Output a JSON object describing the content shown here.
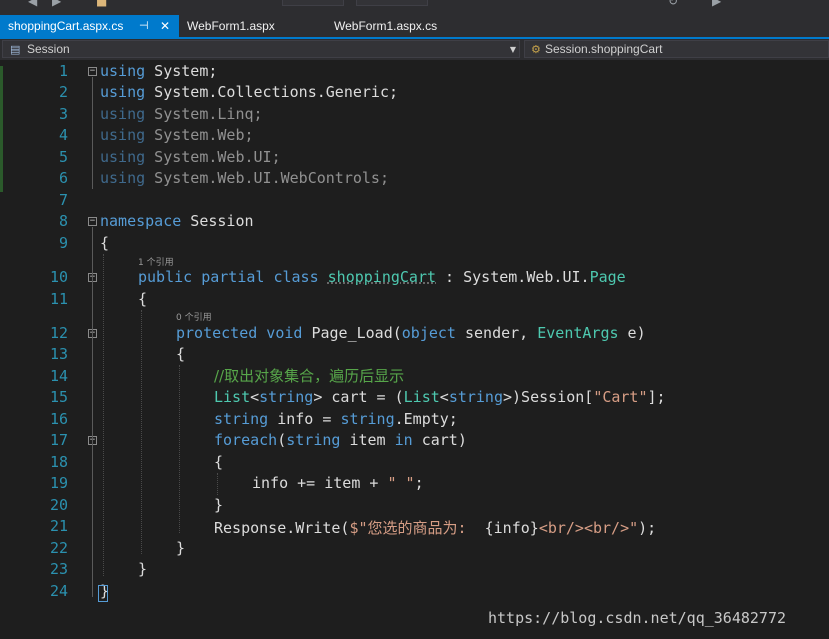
{
  "tabs": [
    {
      "label": "shoppingCart.aspx.cs",
      "active": true
    },
    {
      "label": "WebForm1.aspx",
      "active": false
    },
    {
      "label": "WebForm1.aspx.cs",
      "active": false
    }
  ],
  "nav": {
    "left": "Session",
    "right": "Session.shoppingCart"
  },
  "code": {
    "line_numbers": [
      "1",
      "2",
      "3",
      "4",
      "5",
      "6",
      "7",
      "8",
      "9",
      "10",
      "11",
      "12",
      "13",
      "14",
      "15",
      "16",
      "17",
      "18",
      "19",
      "20",
      "21",
      "22",
      "23",
      "24"
    ],
    "l1_kw": "using",
    "l1_rest": " System;",
    "l2_kw": "using",
    "l2_rest": " System.Collections.Generic;",
    "l3_kw": "using",
    "l3_rest": " System.Linq;",
    "l4_kw": "using",
    "l4_rest": " System.Web;",
    "l5_kw": "using",
    "l5_rest": " System.Web.UI;",
    "l6_kw": "using",
    "l6_rest": " System.Web.UI.WebControls;",
    "l8_kw": "namespace",
    "l8_rest": " Session",
    "l9": "{",
    "ref1": "1 个引用",
    "l10_kw1": "public",
    "l10_kw2": " partial",
    "l10_kw3": " class",
    "l10_sp": " ",
    "l10_cls": "shoppingCart",
    "l10_mid": " : System.Web.UI.",
    "l10_base": "Page",
    "l11": "{",
    "ref2": "0 个引用",
    "l12_kw1": "protected",
    "l12_kw2": " void",
    "l12_mid": " Page_Load(",
    "l12_kw3": "object",
    "l12_mid2": " sender, ",
    "l12_type": "EventArgs",
    "l12_end": " e)",
    "l13": "{",
    "l14": "//取出对象集合，遍历后显示",
    "l15_t1": "List",
    "l15_p1": "<",
    "l15_k1": "string",
    "l15_p2": "> cart = (",
    "l15_t2": "List",
    "l15_p3": "<",
    "l15_k2": "string",
    "l15_p4": ">)Session[",
    "l15_s": "\"Cart\"",
    "l15_end": "];",
    "l16_k1": "string",
    "l16_mid": " info = ",
    "l16_k2": "string",
    "l16_end": ".Empty;",
    "l17_k1": "foreach",
    "l17_p1": "(",
    "l17_k2": "string",
    "l17_mid": " item ",
    "l17_k3": "in",
    "l17_end": " cart)",
    "l18": "{",
    "l19_pre": "info += item + ",
    "l19_s": "\" \"",
    "l19_end": ";",
    "l20": "}",
    "l21_pre": "Response.Write(",
    "l21_s1": "$\"您选的商品为:  ",
    "l21_mid": "{info}",
    "l21_s2": "<br/><br/>\"",
    "l21_end": ");",
    "l22": "}",
    "l23": "}",
    "l24": "}"
  },
  "watermark": "https://blog.csdn.net/qq_36482772",
  "colors": {
    "keyword": "#569cd6",
    "type": "#4ec9b0",
    "string": "#d69d85",
    "comment": "#57a64a",
    "line_number": "#2b91af",
    "tab_active": "#007acc"
  }
}
